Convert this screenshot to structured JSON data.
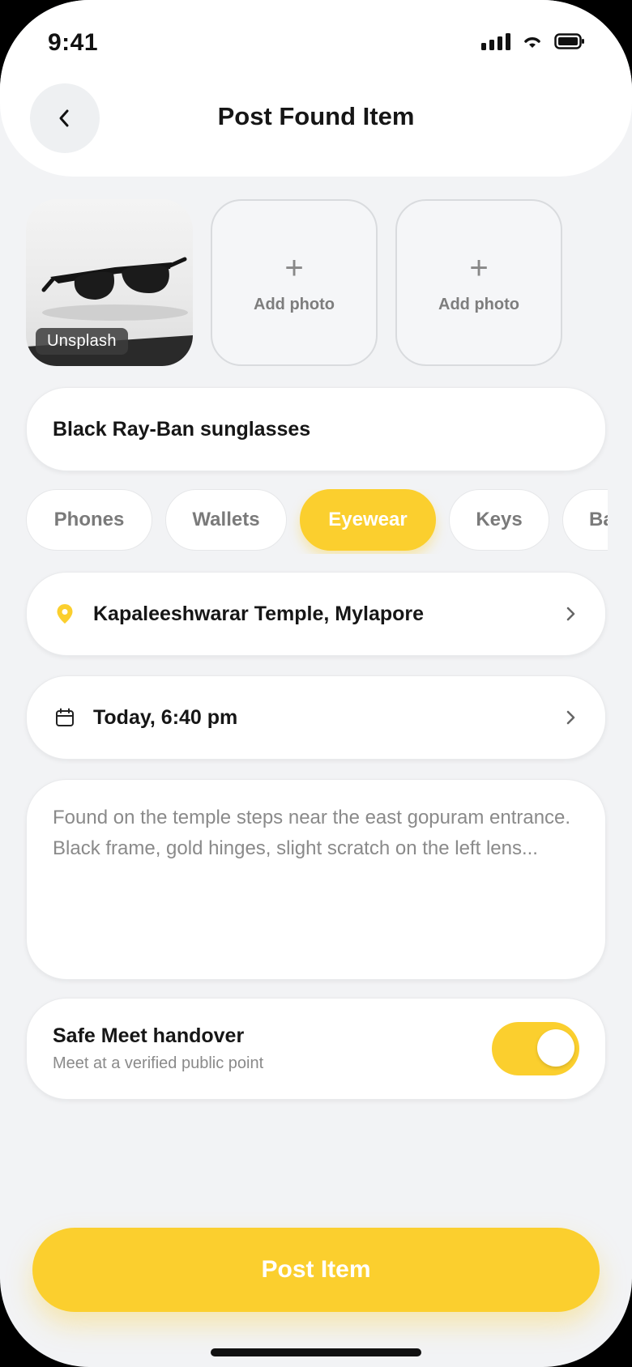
{
  "status_bar": {
    "time": "9:41"
  },
  "header": {
    "title": "Post Found Item"
  },
  "photos": {
    "credit": "Unsplash",
    "add_slots": [
      {
        "label": "Add photo"
      },
      {
        "label": "Add photo"
      }
    ]
  },
  "item": {
    "title": "Black Ray-Ban sunglasses"
  },
  "categories": {
    "items": [
      "Phones",
      "Wallets",
      "Eyewear",
      "Keys",
      "Ba"
    ],
    "selected": "Eyewear"
  },
  "location": {
    "value": "Kapaleeshwarar Temple, Mylapore"
  },
  "date": {
    "value": "Today, 6:40 pm"
  },
  "description": {
    "value": "Found on the temple steps near the east gopuram entrance. Black frame, gold hinges, slight scratch on the left lens..."
  },
  "safe_meet": {
    "title": "Safe Meet handover",
    "subtitle": "Meet at a verified public point",
    "enabled": true
  },
  "submit": {
    "label": "Post Item"
  },
  "colors": {
    "accent": "#fbcf2e",
    "background": "#f2f3f5",
    "card": "#ffffff",
    "text_primary": "#161616",
    "text_secondary": "#8a8a8a"
  }
}
